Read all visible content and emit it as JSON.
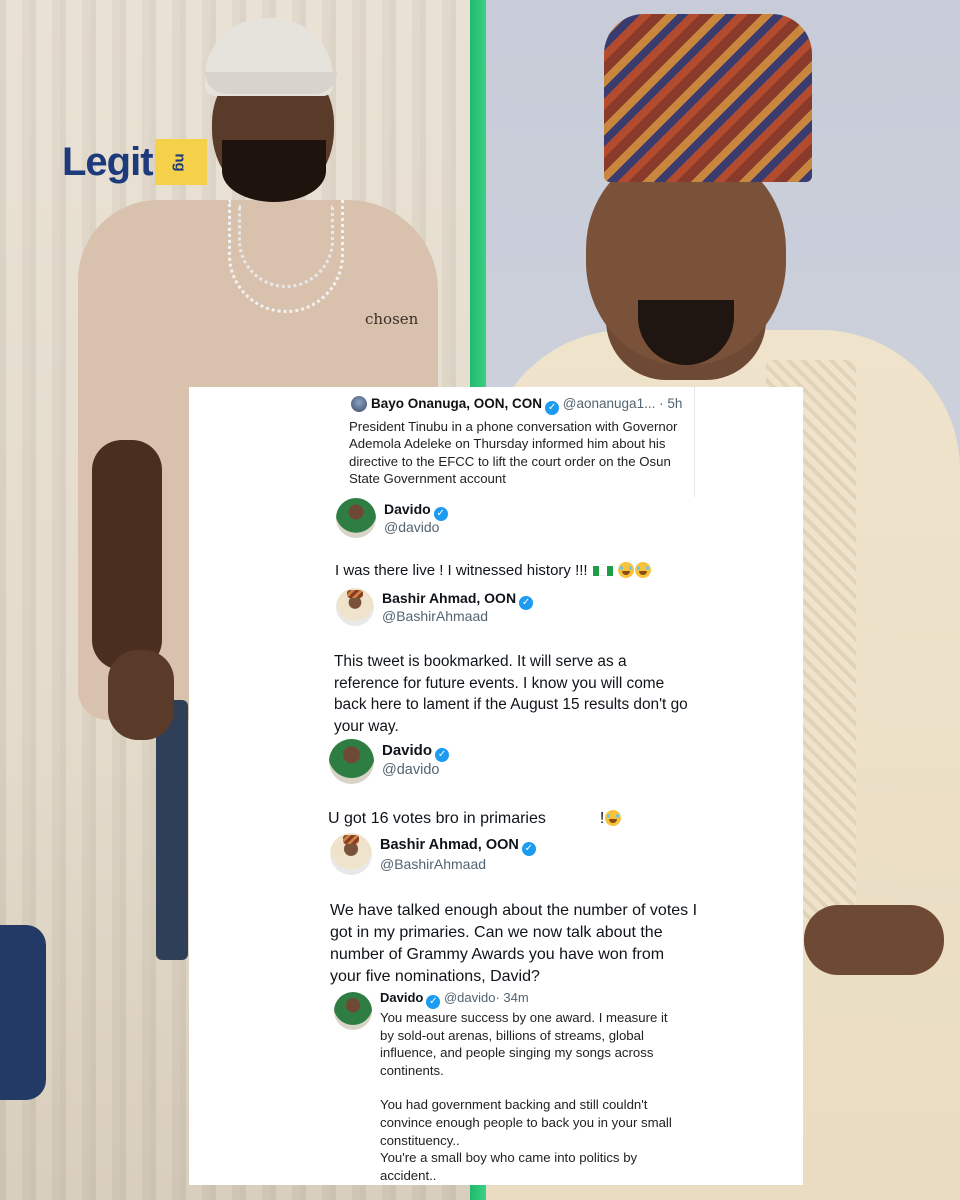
{
  "logo": {
    "text": "Legit",
    "suffix": "ng"
  },
  "left_photo": {
    "shirt_text": "chosen"
  },
  "card": {
    "quoted_tweet": {
      "author": "Bayo Onanuga, OON, CON",
      "handle": "@aonanuga1...",
      "time": "· 5h",
      "text": "President Tinubu in a phone conversation with Governor Ademola Adeleke on Thursday informed him about his directive to the EFCC to lift the court order on the Osun State Government account"
    },
    "posts": [
      {
        "author": "Davido",
        "handle": "@davido",
        "text": "I was there live ! I witnessed history !!!"
      },
      {
        "author": "Bashir Ahmad, OON",
        "handle": "@BashirAhmaad",
        "text": "This tweet is bookmarked. It will serve as a reference for future events. I know you will come back here to lament if the August 15 results don't go your way."
      },
      {
        "author": "Davido",
        "handle": "@davido",
        "text": "U got 16 votes bro in primaries"
      },
      {
        "author": "Bashir Ahmad, OON",
        "handle": "@BashirAhmaad",
        "text": "We have talked enough about the number of votes I got in my primaries. Can we now talk about the number of Grammy Awards you have won from your five nominations, David?"
      }
    ],
    "final_reply": {
      "author": "Davido",
      "handle": "@davido",
      "time": "· 34m",
      "para1": "You measure success by one award. I measure it by sold-out arenas, billions of streams, global influence, and people singing my songs across continents.",
      "para2": "You had government backing and still couldn't convince enough people to back you in your small constituency..",
      "para3": "You're a small boy who came into politics by accident.."
    },
    "punctuation": "!"
  },
  "colors": {
    "verified": "#1d9bf0",
    "divider": "#1fb96c",
    "logo_blue": "#1d3a7d",
    "logo_yellow": "#f5d14a"
  }
}
